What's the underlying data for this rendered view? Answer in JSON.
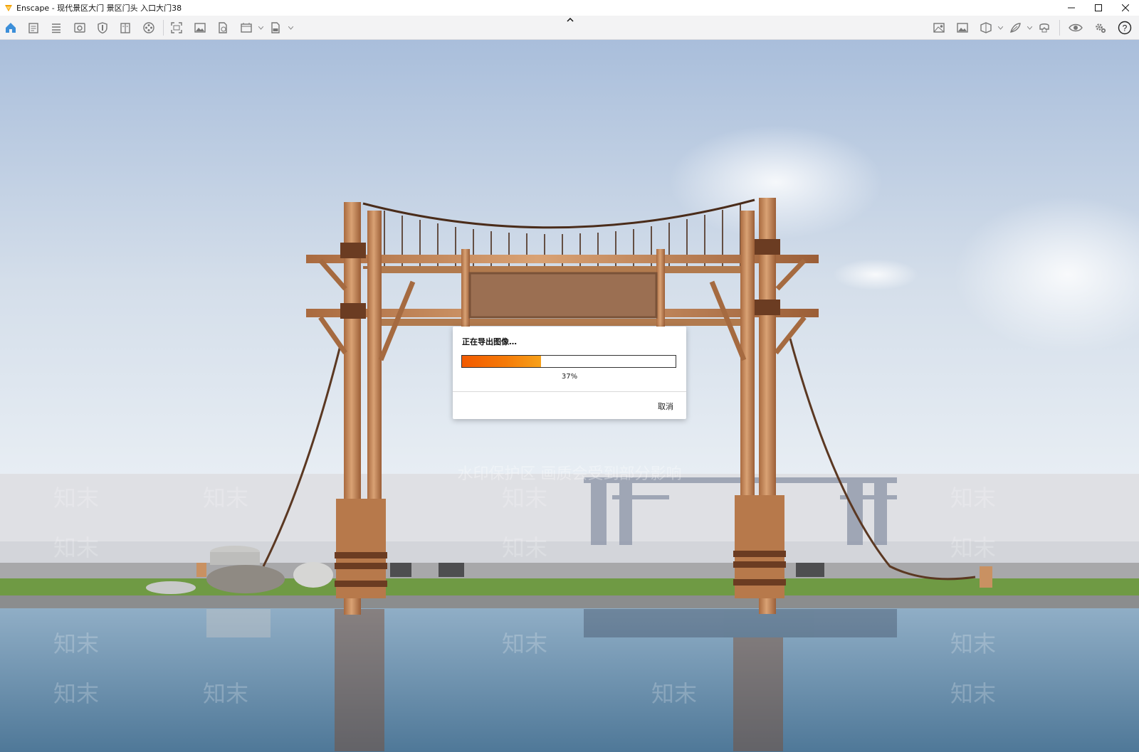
{
  "window": {
    "title": "Enscape - 现代景区大门 景区门头 入口大门38",
    "controls": [
      "minimize-icon",
      "maximize-icon",
      "close-icon"
    ]
  },
  "toolbar": {
    "left_icons": [
      "home-icon",
      "notes-icon",
      "list-icon",
      "view-icon",
      "shield-icon",
      "book-icon",
      "film-reel-icon",
      "screenshot-icon",
      "image-icon",
      "file-icon",
      "panorama-icon",
      "exe-export-icon"
    ],
    "right_icons": [
      "map-icon",
      "gallery-icon",
      "cube-icon",
      "feather-icon",
      "vr-headset-icon",
      "eye-icon",
      "settings-icon",
      "help-icon"
    ],
    "collapse_icon": "chevron-up-icon"
  },
  "viewport": {
    "watermark_line": "水印保护区 画质会受到部分影响",
    "watermark_tile": "知末",
    "colors": {
      "sky_top": "#a9bedb",
      "sky_bottom": "#e8eef4",
      "water": "#5f87a6",
      "grass": "#6f9a44",
      "wood": "#c48a5c",
      "sign_board": "#9b6f52",
      "wall": "#dedfe2"
    }
  },
  "dialog": {
    "title": "正在导出图像…",
    "progress_value": 0.37,
    "progress_text": "37%",
    "cancel_label": "取消",
    "accent_color": "#f57a08"
  }
}
